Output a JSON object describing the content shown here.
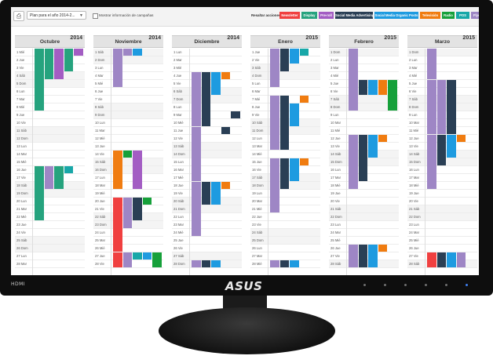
{
  "monitor": {
    "port_label": "HDMI",
    "brand": "ASUS"
  },
  "toolbar": {
    "print_icon": "printer-icon",
    "plan_select": "Plan para el año 2014-2...",
    "show_campaign_label": "Mostrar información de campañas",
    "highlight_label": "Resaltar acciones:"
  },
  "action_types": [
    {
      "label": "Newsletter",
      "color": "#f04040"
    },
    {
      "label": "Display",
      "color": "#26a37e"
    },
    {
      "label": "Pre-roll",
      "color": "#a35dc3"
    },
    {
      "label": "Social Media Advertising",
      "color": "#2a3f55"
    },
    {
      "label": "Social Media Organic Posts",
      "color": "#1e9be0"
    },
    {
      "label": "Televisión",
      "color": "#f07c10"
    },
    {
      "label": "Radio",
      "color": "#16a03a"
    },
    {
      "label": "POS",
      "color": "#18a7a8"
    },
    {
      "label": "Flyer",
      "color": "#9e86c5"
    }
  ],
  "months": [
    {
      "name": "Octubre",
      "year": "2014",
      "days": [
        "1 Mié",
        "2 Jue",
        "3 Vie",
        "4 Sáb",
        "5 Dom",
        "6 Lun",
        "7 Mar",
        "8 Mié",
        "9 Jue",
        "10 Vie",
        "11 Sáb",
        "12 Dom",
        "13 Lun",
        "14 Mar",
        "15 Mié",
        "16 Jue",
        "17 Vie",
        "18 Sáb",
        "19 Dom",
        "20 Lun",
        "21 Mar",
        "22 Mié",
        "23 Jue",
        "24 Vie",
        "25 Sáb",
        "26 Dom",
        "27 Lun",
        "28 Mar"
      ],
      "weekend": [
        4,
        5,
        11,
        12,
        18,
        19,
        25,
        26
      ],
      "bars": [
        {
          "type": "Display",
          "lane": 0,
          "start": 1,
          "end": 8
        },
        {
          "type": "Display",
          "lane": 1,
          "start": 1,
          "end": 4
        },
        {
          "type": "Pre-roll",
          "lane": 2,
          "start": 1,
          "end": 4
        },
        {
          "type": "Display",
          "lane": 3,
          "start": 1,
          "end": 3
        },
        {
          "type": "Pre-roll",
          "lane": 4,
          "start": 1,
          "end": 1
        },
        {
          "type": "Display",
          "lane": 0,
          "start": 16,
          "end": 22
        },
        {
          "type": "Flyer",
          "lane": 1,
          "start": 16,
          "end": 18
        },
        {
          "type": "Display",
          "lane": 2,
          "start": 16,
          "end": 18
        },
        {
          "type": "POS",
          "lane": 3,
          "start": 16,
          "end": 16
        }
      ]
    },
    {
      "name": "Noviembre",
      "year": "2014",
      "days": [
        "1 Sáb",
        "2 Dom",
        "3 Lun",
        "4 Mar",
        "5 Mié",
        "6 Jue",
        "7 Vie",
        "8 Sáb",
        "9 Dom",
        "10 Lun",
        "11 Mar",
        "12 Mié",
        "13 Jue",
        "14 Vie",
        "15 Sáb",
        "16 Dom",
        "17 Lun",
        "18 Mar",
        "19 Mié",
        "20 Jue",
        "21 Vie",
        "22 Sáb",
        "23 Dom",
        "24 Lun",
        "25 Mar",
        "26 Mié",
        "27 Jue",
        "28 Vie"
      ],
      "weekend": [
        1,
        2,
        8,
        9,
        15,
        16,
        22,
        23
      ],
      "bars": [
        {
          "type": "Flyer",
          "lane": 0,
          "start": 1,
          "end": 5
        },
        {
          "type": "Flyer",
          "lane": 1,
          "start": 1,
          "end": 1
        },
        {
          "type": "Social Media Organic Posts",
          "lane": 2,
          "start": 1,
          "end": 1
        },
        {
          "type": "Televisión",
          "lane": 0,
          "start": 14,
          "end": 18
        },
        {
          "type": "Radio",
          "lane": 1,
          "start": 14,
          "end": 14
        },
        {
          "type": "Pre-roll",
          "lane": 2,
          "start": 14,
          "end": 18
        },
        {
          "type": "Newsletter",
          "lane": 0,
          "start": 20,
          "end": 26
        },
        {
          "type": "Flyer",
          "lane": 1,
          "start": 20,
          "end": 23
        },
        {
          "type": "Social Media Advertising",
          "lane": 2,
          "start": 20,
          "end": 22
        },
        {
          "type": "Radio",
          "lane": 3,
          "start": 20,
          "end": 20
        },
        {
          "type": "Newsletter",
          "lane": 0,
          "start": 27,
          "end": 28
        },
        {
          "type": "Flyer",
          "lane": 1,
          "start": 27,
          "end": 28
        },
        {
          "type": "POS",
          "lane": 2,
          "start": 27,
          "end": 27
        },
        {
          "type": "Social Media Organic Posts",
          "lane": 3,
          "start": 27,
          "end": 27
        },
        {
          "type": "Radio",
          "lane": 4,
          "start": 27,
          "end": 28
        }
      ]
    },
    {
      "name": "Diciembre",
      "year": "2014",
      "days": [
        "1 Lun",
        "2 Mar",
        "3 Mié",
        "4 Jue",
        "5 Vie",
        "6 Sáb",
        "7 Dom",
        "8 Lun",
        "9 Mar",
        "10 Mié",
        "11 Jue",
        "12 Vie",
        "13 Sáb",
        "14 Dom",
        "15 Lun",
        "16 Mar",
        "17 Mié",
        "18 Jue",
        "19 Vie",
        "20 Sáb",
        "21 Dom",
        "22 Lun",
        "23 Mar",
        "24 Mié",
        "25 Jue",
        "26 Vie",
        "27 Sáb",
        "28 Dom"
      ],
      "weekend": [
        6,
        7,
        13,
        14,
        20,
        21,
        27,
        28
      ],
      "bars": [
        {
          "type": "Flyer",
          "lane": 0,
          "start": 4,
          "end": 10
        },
        {
          "type": "Social Media Advertising",
          "lane": 1,
          "start": 4,
          "end": 10
        },
        {
          "type": "Social Media Organic Posts",
          "lane": 2,
          "start": 4,
          "end": 6
        },
        {
          "type": "Televisión",
          "lane": 3,
          "start": 4,
          "end": 4
        },
        {
          "type": "Social Media Advertising",
          "lane": 4,
          "start": 9,
          "end": 9
        },
        {
          "type": "Flyer",
          "lane": 0,
          "start": 11,
          "end": 17
        },
        {
          "type": "Social Media Advertising",
          "lane": 3,
          "start": 11,
          "end": 11
        },
        {
          "type": "Flyer",
          "lane": 0,
          "start": 18,
          "end": 24
        },
        {
          "type": "Social Media Advertising",
          "lane": 1,
          "start": 18,
          "end": 20
        },
        {
          "type": "Social Media Organic Posts",
          "lane": 2,
          "start": 18,
          "end": 20
        },
        {
          "type": "Televisión",
          "lane": 3,
          "start": 18,
          "end": 18
        },
        {
          "type": "Flyer",
          "lane": 0,
          "start": 28,
          "end": 28
        },
        {
          "type": "Social Media Advertising",
          "lane": 1,
          "start": 28,
          "end": 28
        },
        {
          "type": "Social Media Organic Posts",
          "lane": 2,
          "start": 28,
          "end": 28
        }
      ]
    },
    {
      "name": "Enero",
      "year": "2015",
      "days": [
        "1 Jue",
        "2 Vie",
        "3 Sáb",
        "4 Dom",
        "5 Lun",
        "6 Mar",
        "7 Mié",
        "8 Jue",
        "9 Vie",
        "10 Sáb",
        "11 Dom",
        "12 Lun",
        "13 Mar",
        "14 Mié",
        "15 Jue",
        "16 Vie",
        "17 Sáb",
        "18 Dom",
        "19 Lun",
        "20 Mar",
        "21 Mié",
        "22 Jue",
        "23 Vie",
        "24 Sáb",
        "25 Dom",
        "26 Lun",
        "27 Mar",
        "28 Mié"
      ],
      "weekend": [
        3,
        4,
        10,
        11,
        17,
        18,
        24,
        25
      ],
      "bars": [
        {
          "type": "Flyer",
          "lane": 0,
          "start": 1,
          "end": 5
        },
        {
          "type": "Social Media Advertising",
          "lane": 1,
          "start": 1,
          "end": 3
        },
        {
          "type": "Social Media Organic Posts",
          "lane": 2,
          "start": 1,
          "end": 2
        },
        {
          "type": "POS",
          "lane": 3,
          "start": 1,
          "end": 1
        },
        {
          "type": "Flyer",
          "lane": 0,
          "start": 7,
          "end": 13
        },
        {
          "type": "Social Media Advertising",
          "lane": 1,
          "start": 7,
          "end": 13
        },
        {
          "type": "Social Media Organic Posts",
          "lane": 2,
          "start": 8,
          "end": 10
        },
        {
          "type": "Televisión",
          "lane": 3,
          "start": 7,
          "end": 7
        },
        {
          "type": "Flyer",
          "lane": 0,
          "start": 15,
          "end": 21
        },
        {
          "type": "Social Media Advertising",
          "lane": 1,
          "start": 15,
          "end": 18
        },
        {
          "type": "Social Media Organic Posts",
          "lane": 2,
          "start": 15,
          "end": 17
        },
        {
          "type": "Televisión",
          "lane": 3,
          "start": 15,
          "end": 15
        },
        {
          "type": "Flyer",
          "lane": 0,
          "start": 28,
          "end": 28
        },
        {
          "type": "Social Media Advertising",
          "lane": 1,
          "start": 28,
          "end": 28
        },
        {
          "type": "Social Media Organic Posts",
          "lane": 2,
          "start": 28,
          "end": 28
        }
      ]
    },
    {
      "name": "Febrero",
      "year": "2015",
      "days": [
        "1 Dom",
        "2 Lun",
        "3 Mar",
        "4 Mié",
        "5 Jue",
        "6 Vie",
        "7 Sáb",
        "8 Dom",
        "9 Lun",
        "10 Mar",
        "11 Mié",
        "12 Jue",
        "13 Vie",
        "14 Sáb",
        "15 Dom",
        "16 Lun",
        "17 Mar",
        "18 Mié",
        "19 Jue",
        "20 Vie",
        "21 Sáb",
        "22 Dom",
        "23 Lun",
        "24 Mar",
        "25 Mié",
        "26 Jue",
        "27 Vie",
        "28 Sáb"
      ],
      "weekend": [
        1,
        7,
        8,
        14,
        15,
        21,
        22,
        28
      ],
      "bars": [
        {
          "type": "Flyer",
          "lane": 0,
          "start": 1,
          "end": 8
        },
        {
          "type": "Social Media Advertising",
          "lane": 1,
          "start": 5,
          "end": 6
        },
        {
          "type": "Social Media Organic Posts",
          "lane": 2,
          "start": 5,
          "end": 6
        },
        {
          "type": "Televisión",
          "lane": 3,
          "start": 5,
          "end": 6
        },
        {
          "type": "Radio",
          "lane": 4,
          "start": 5,
          "end": 8
        },
        {
          "type": "Flyer",
          "lane": 0,
          "start": 12,
          "end": 18
        },
        {
          "type": "Social Media Advertising",
          "lane": 1,
          "start": 12,
          "end": 17
        },
        {
          "type": "Social Media Organic Posts",
          "lane": 2,
          "start": 12,
          "end": 14
        },
        {
          "type": "Televisión",
          "lane": 3,
          "start": 12,
          "end": 12
        },
        {
          "type": "Flyer",
          "lane": 0,
          "start": 26,
          "end": 28
        },
        {
          "type": "Social Media Advertising",
          "lane": 1,
          "start": 26,
          "end": 28
        },
        {
          "type": "Social Media Organic Posts",
          "lane": 2,
          "start": 26,
          "end": 28
        },
        {
          "type": "Televisión",
          "lane": 3,
          "start": 26,
          "end": 26
        }
      ]
    },
    {
      "name": "Marzo",
      "year": "2015",
      "days": [
        "1 Dom",
        "2 Lun",
        "3 Mar",
        "4 Mié",
        "5 Jue",
        "6 Vie",
        "7 Sáb",
        "8 Dom",
        "9 Lun",
        "10 Mar",
        "11 Mié",
        "12 Jue",
        "13 Vie",
        "14 Sáb",
        "15 Dom",
        "16 Lun",
        "17 Mar",
        "18 Mié",
        "19 Jue",
        "20 Vie",
        "21 Sáb",
        "22 Dom",
        "23 Lun",
        "24 Mar",
        "25 Mié",
        "26 Jue",
        "27 Vie",
        "28 Sáb"
      ],
      "weekend": [
        1,
        7,
        8,
        14,
        15,
        21,
        22,
        28
      ],
      "bars": [
        {
          "type": "Flyer",
          "lane": 0,
          "start": 1,
          "end": 4
        },
        {
          "type": "Flyer",
          "lane": 0,
          "start": 5,
          "end": 11
        },
        {
          "type": "Flyer",
          "lane": 1,
          "start": 5,
          "end": 11
        },
        {
          "type": "Social Media Advertising",
          "lane": 2,
          "start": 5,
          "end": 11
        },
        {
          "type": "Flyer",
          "lane": 0,
          "start": 12,
          "end": 18
        },
        {
          "type": "Social Media Advertising",
          "lane": 1,
          "start": 12,
          "end": 15
        },
        {
          "type": "Social Media Organic Posts",
          "lane": 2,
          "start": 12,
          "end": 14
        },
        {
          "type": "Televisión",
          "lane": 3,
          "start": 12,
          "end": 12
        },
        {
          "type": "Newsletter",
          "lane": 0,
          "start": 27,
          "end": 28
        },
        {
          "type": "Social Media Advertising",
          "lane": 1,
          "start": 27,
          "end": 28
        },
        {
          "type": "Social Media Organic Posts",
          "lane": 2,
          "start": 27,
          "end": 28
        },
        {
          "type": "Flyer",
          "lane": 3,
          "start": 27,
          "end": 28
        }
      ]
    }
  ]
}
